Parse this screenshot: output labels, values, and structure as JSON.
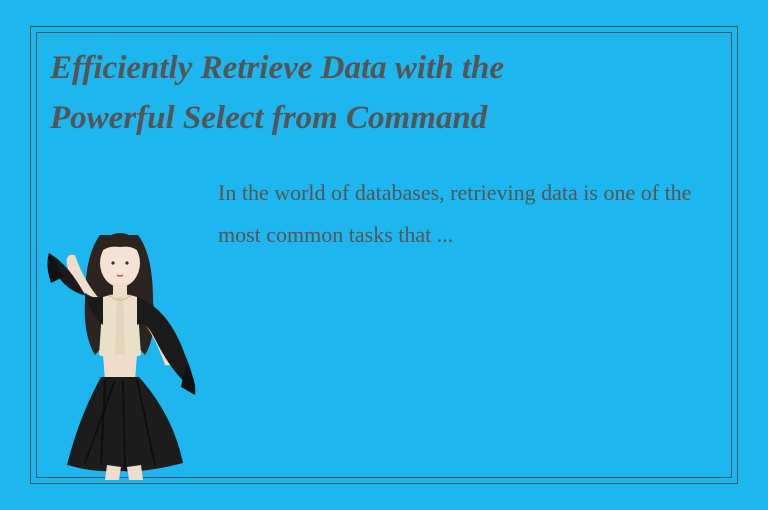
{
  "title_line1": "Efficiently Retrieve Data with the",
  "title_line2": " Powerful Select from Command",
  "body": "In the world of databases, retrieving data is one of the most common tasks that ..."
}
